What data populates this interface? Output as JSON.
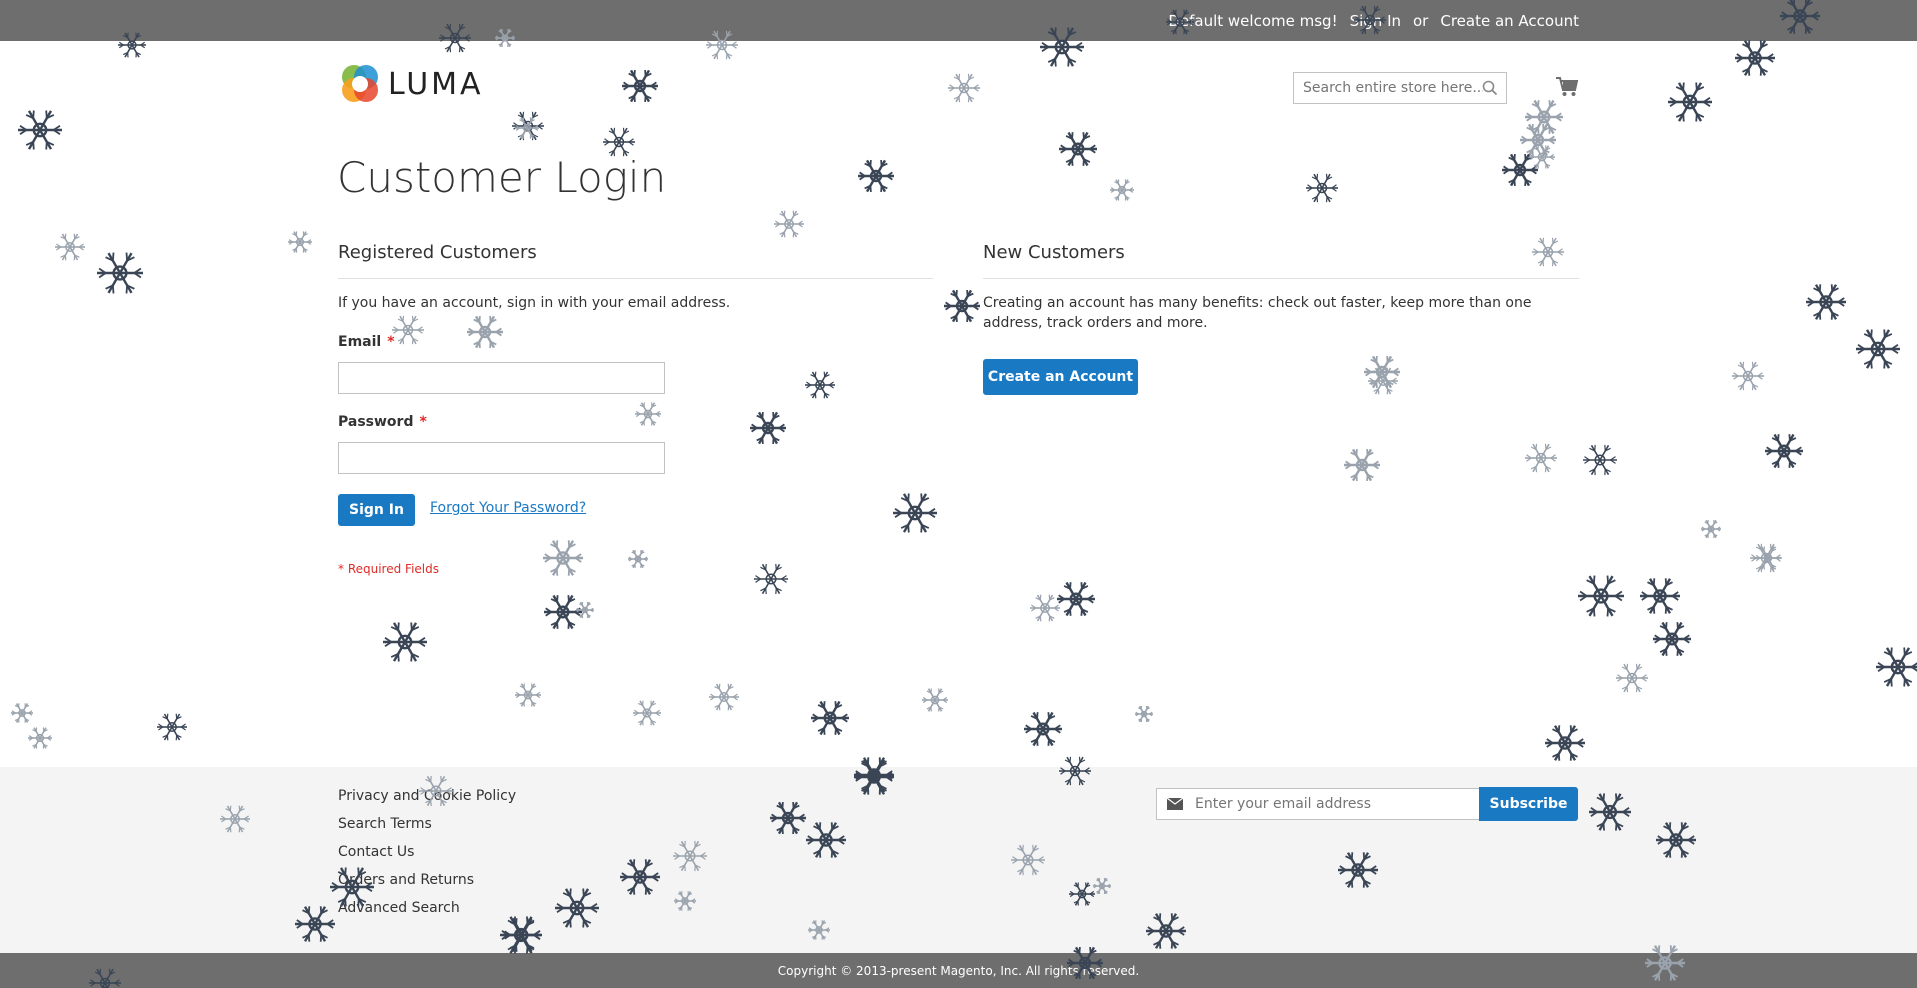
{
  "header": {
    "welcome": "Default welcome msg!",
    "sign_in_link": "Sign In",
    "separator": "or",
    "create_account_link": "Create an Account",
    "logo_text": "LUMA",
    "search_placeholder": "Search entire store here..."
  },
  "page_title": "Customer Login",
  "registered": {
    "title": "Registered Customers",
    "intro": "If you have an account, sign in with your email address.",
    "email_label": "Email",
    "password_label": "Password",
    "required_mark": "*",
    "sign_in_button": "Sign In",
    "forgot_link": "Forgot Your Password?",
    "required_note": "* Required Fields"
  },
  "new_customers": {
    "title": "New Customers",
    "intro": "Creating an account has many benefits: check out faster, keep more than one address, track orders and more.",
    "create_button": "Create an Account"
  },
  "footer": {
    "links": [
      "Privacy and Cookie Policy",
      "Search Terms",
      "Contact Us",
      "Orders and Returns",
      "Advanced Search"
    ],
    "newsletter_placeholder": "Enter your email address",
    "subscribe_button": "Subscribe",
    "copyright": "Copyright © 2013-present Magento, Inc. All rights reserved."
  },
  "colors": {
    "accent": "#1979c3",
    "top_bar": "#6e6e6e",
    "footer_bg": "#f4f4f4",
    "required": "#e02b27",
    "snowflake_dark": "#3a4555",
    "snowflake_light": "#9aa3ad"
  },
  "icons": {
    "search": "search-icon",
    "cart": "cart-icon",
    "mail": "envelope-icon",
    "decor": "snowflake-icon"
  }
}
